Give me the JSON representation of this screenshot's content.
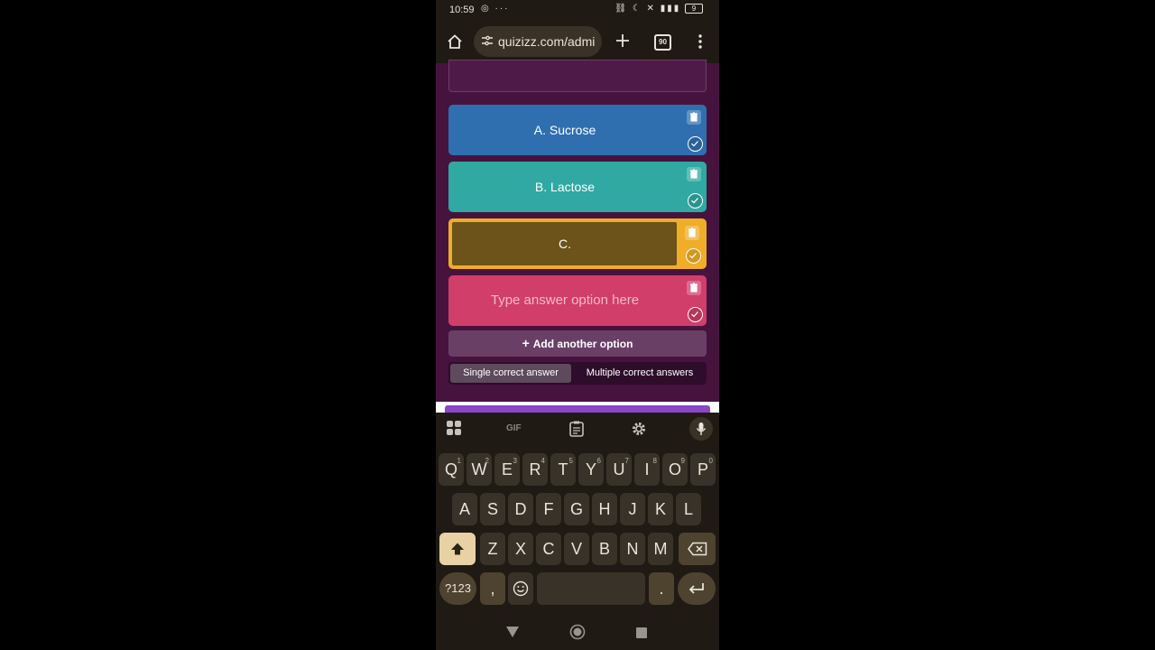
{
  "status_bar": {
    "time": "10:59",
    "notif_icons": "◎ ···",
    "right_icons": "⛓ ☾ ✕ ▮▮▮",
    "battery": "9"
  },
  "browser": {
    "url": "quizizz.com/admi",
    "tab_count": "90",
    "icons": [
      "home-icon",
      "site-settings-icon",
      "new-tab-icon",
      "tabs-icon",
      "more-vert-icon"
    ]
  },
  "options": [
    {
      "label": "A. Sucrose",
      "color": "#2f6fb0"
    },
    {
      "label": "B. Lactose",
      "color": "#2fa9a2"
    },
    {
      "label": "C.",
      "color": "#f0ad28"
    },
    {
      "placeholder": "Type answer option here",
      "color": "#d13e6a"
    }
  ],
  "add_option": {
    "label": "Add another option"
  },
  "answer_mode": {
    "single": "Single correct answer",
    "multiple": "Multiple correct answers",
    "selected": "single"
  },
  "keyboard": {
    "toolbar": {
      "gif": "GIF"
    },
    "row1": [
      [
        "Q",
        "1"
      ],
      [
        "W",
        "2"
      ],
      [
        "E",
        "3"
      ],
      [
        "R",
        "4"
      ],
      [
        "T",
        "5"
      ],
      [
        "Y",
        "6"
      ],
      [
        "U",
        "7"
      ],
      [
        "I",
        "8"
      ],
      [
        "O",
        "9"
      ],
      [
        "P",
        "0"
      ]
    ],
    "row2": [
      "A",
      "S",
      "D",
      "F",
      "G",
      "H",
      "J",
      "K",
      "L"
    ],
    "row3": [
      "Z",
      "X",
      "C",
      "V",
      "B",
      "N",
      "M"
    ],
    "symbols": "?123",
    "comma": ",",
    "period": "."
  }
}
